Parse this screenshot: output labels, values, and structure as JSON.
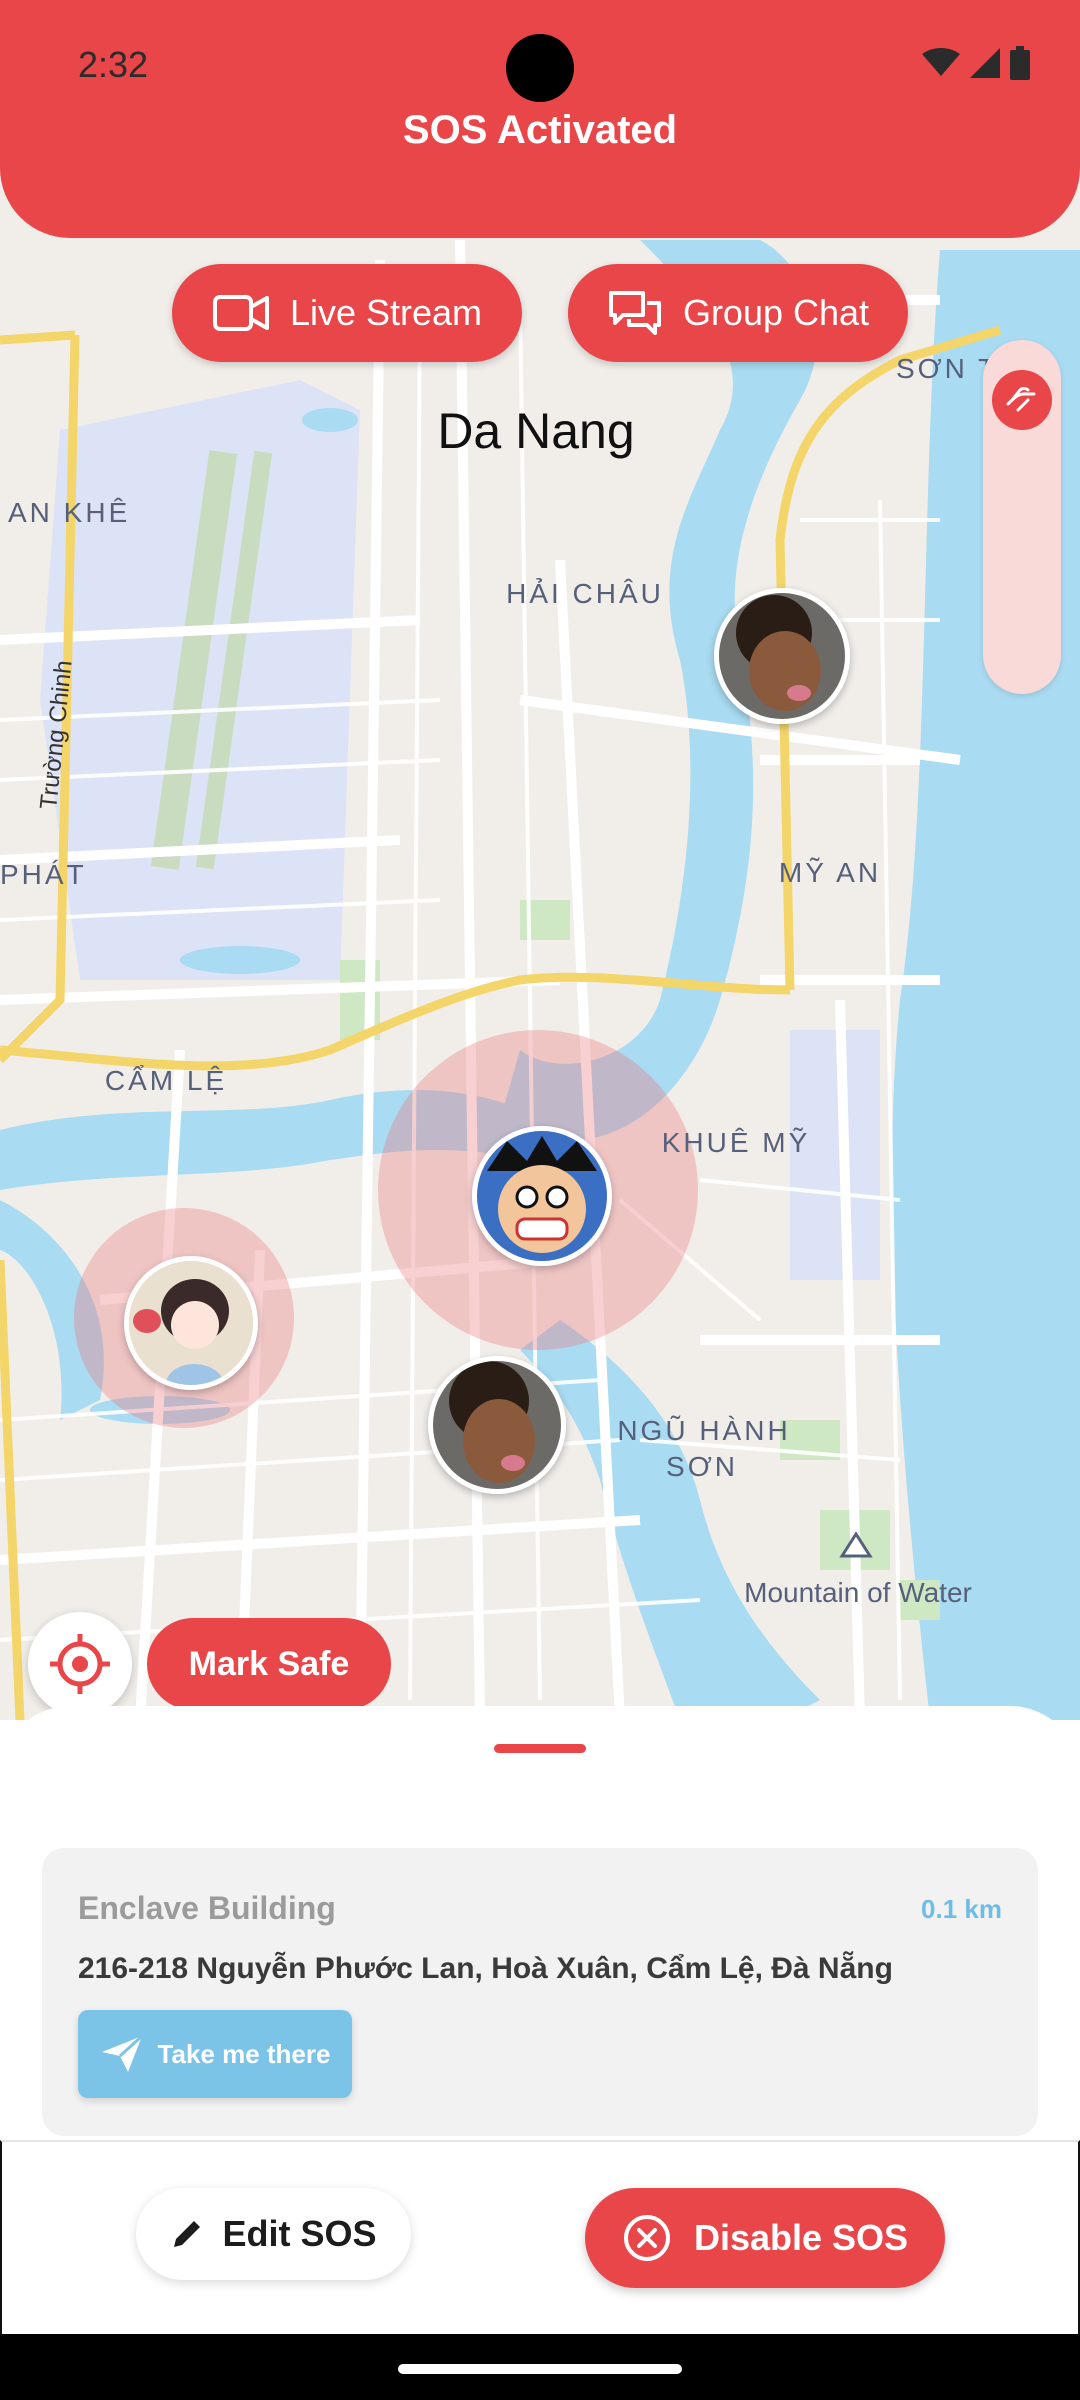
{
  "status_bar": {
    "time": "2:32"
  },
  "header": {
    "title": "SOS Activated"
  },
  "actions": {
    "live_stream": "Live Stream",
    "group_chat": "Group Chat"
  },
  "map": {
    "city_label": "Da Nang",
    "labels": [
      {
        "text": "HẢI CHÂU",
        "id": "hai-chau"
      },
      {
        "text": "AN KHÊ",
        "id": "an-khe"
      },
      {
        "text": "PHÁT",
        "id": "phat"
      },
      {
        "text": "MỸ AN",
        "id": "my-an"
      },
      {
        "text": "CẨM LỆ",
        "id": "cam-le"
      },
      {
        "text": "KHUÊ MỸ",
        "id": "khue-my"
      },
      {
        "text": "NGŨ HÀNH",
        "id": "ngu-hanh"
      },
      {
        "text": "SƠN",
        "id": "son"
      },
      {
        "text": "SƠN T",
        "id": "son-t"
      },
      {
        "text": "Trường Chinh",
        "id": "truong-chinh"
      },
      {
        "text": "Mountain of Water",
        "id": "mountain-of-water"
      }
    ]
  },
  "map_controls": {
    "mark_safe": "Mark Safe"
  },
  "destination": {
    "name": "Enclave Building",
    "distance": "0.1 km",
    "address": "216-218 Nguyễn Phước Lan, Hoà Xuân, Cẩm Lệ, Đà Nẵng",
    "button": "Take me there"
  },
  "bottom": {
    "edit": "Edit SOS",
    "disable": "Disable SOS"
  },
  "colors": {
    "accent": "#E9464A",
    "water": "#A9DBF2",
    "land": "#F1EEEA",
    "info_blue": "#7CC3E8"
  }
}
